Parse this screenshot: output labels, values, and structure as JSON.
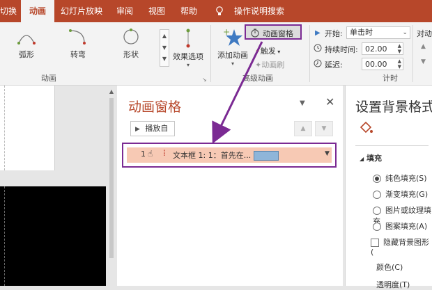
{
  "tabs": [
    "切换",
    "动画",
    "幻灯片放映",
    "审阅",
    "视图",
    "帮助",
    "操作说明搜索"
  ],
  "ribbon": {
    "effects": [
      "弧形",
      "转弯",
      "形状"
    ],
    "effect_options": "效果选项",
    "group_animation": "动画",
    "add_animation": "添加动画",
    "animation_pane": "动画窗格",
    "trigger": "触发",
    "animation_painter": "动画刷",
    "group_advanced": "高级动画",
    "start_label": "开始:",
    "start_value": "单击时",
    "duration_label": "持续时间:",
    "duration_value": "02.00",
    "delay_label": "延迟:",
    "delay_value": "00.00",
    "group_timing": "计时",
    "reorder_partial": "对动"
  },
  "anim_pane": {
    "title": "动画窗格",
    "play_button": "播放自",
    "item_number": "1",
    "item_text": "文本框 1: 1：首先在..."
  },
  "bg_pane": {
    "title": "设置背景格式",
    "section": "填充",
    "options": [
      "纯色填充(S)",
      "渐变填充(G)",
      "图片或纹理填充",
      "图案填充(A)"
    ],
    "hide_bg": "隐藏背景图形(",
    "color_label": "颜色(C)",
    "transparency_partial": "透明度(T)"
  },
  "colors": {
    "accent": "#b7472a",
    "highlight": "#7b2a93",
    "item_bg": "#f7c9b4"
  }
}
